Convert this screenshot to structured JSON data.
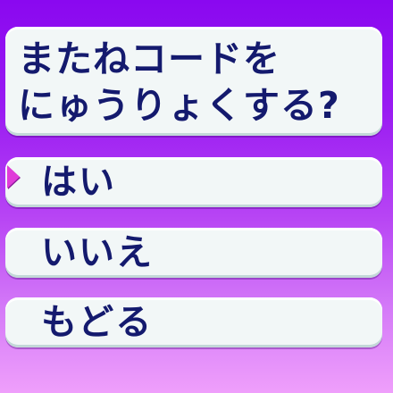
{
  "dialog": {
    "prompt_lines": [
      "またねコードを",
      "にゅうりょくする?"
    ]
  },
  "menu": {
    "options": [
      {
        "label": "はい",
        "selected": true
      },
      {
        "label": "いいえ",
        "selected": false
      },
      {
        "label": "もどる",
        "selected": false
      }
    ],
    "cursor_icon": "right-pointing-triangle",
    "cursor_color": "#e03cd8"
  },
  "colors": {
    "text": "#141a6e",
    "panel": "#f2f7f7",
    "background_top": "#8a08f0",
    "background_bottom": "#ef9ffb"
  }
}
